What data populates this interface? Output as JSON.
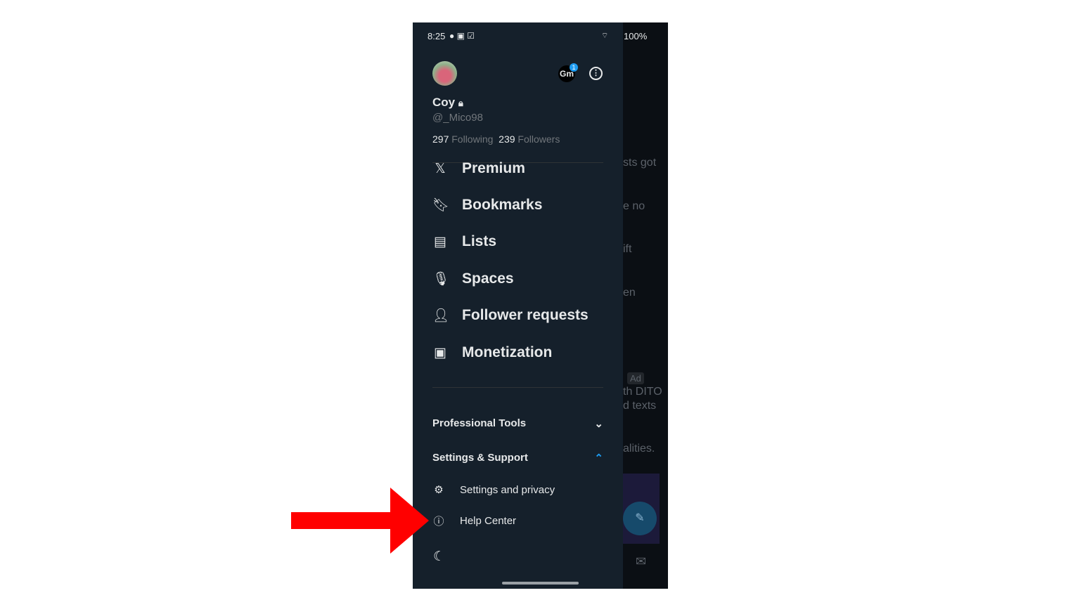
{
  "status_bar": {
    "time": "8:25",
    "battery": "100%"
  },
  "profile": {
    "name": "Coy",
    "handle": "@_Mico98",
    "following_count": "297",
    "following_label": "Following",
    "followers_count": "239",
    "followers_label": "Followers",
    "badge_count": "1"
  },
  "menu": [
    {
      "label": "Premium",
      "icon": "x-logo-icon"
    },
    {
      "label": "Bookmarks",
      "icon": "bookmark-icon"
    },
    {
      "label": "Lists",
      "icon": "list-icon"
    },
    {
      "label": "Spaces",
      "icon": "spaces-icon"
    },
    {
      "label": "Follower requests",
      "icon": "follower-request-icon"
    },
    {
      "label": "Monetization",
      "icon": "monetization-icon"
    }
  ],
  "sections": {
    "professional_tools": "Professional Tools",
    "settings_support": "Settings & Support"
  },
  "settings_items": [
    {
      "label": "Settings and privacy",
      "icon": "gear-icon"
    },
    {
      "label": "Help Center",
      "icon": "help-icon"
    }
  ],
  "background_feed": [
    "sts got",
    "e no",
    "ift",
    "en",
    "Ad",
    "th DITO",
    "d texts",
    "alities."
  ],
  "colors": {
    "drawer": "#15202b",
    "accent": "#1d9bf0",
    "arrow": "#ff0000"
  }
}
